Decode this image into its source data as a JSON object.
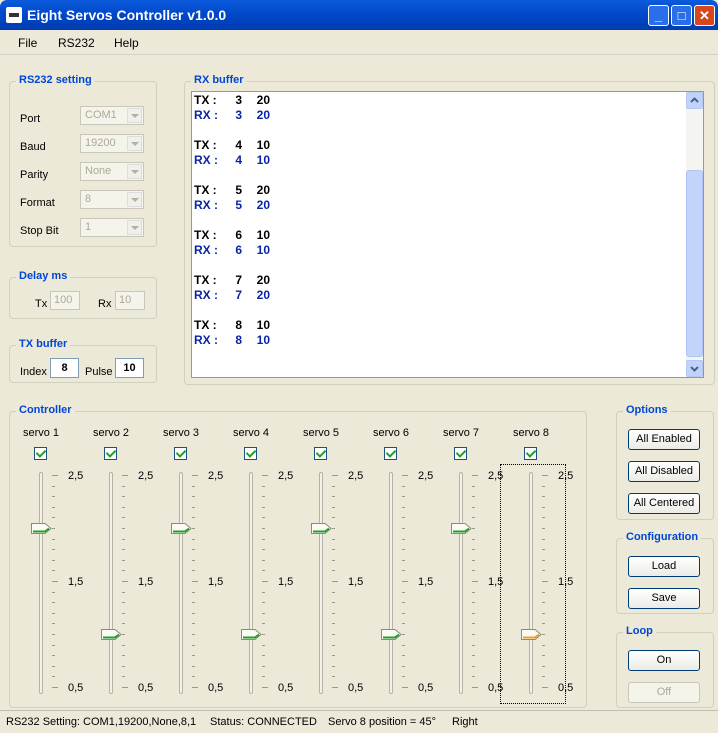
{
  "window": {
    "title": "Eight Servos Controller v1.0.0"
  },
  "menu": {
    "items": [
      "File",
      "RS232",
      "Help"
    ]
  },
  "rs232": {
    "label": "RS232 setting",
    "fields": [
      {
        "label": "Port",
        "value": "COM1"
      },
      {
        "label": "Baud",
        "value": "19200"
      },
      {
        "label": "Parity",
        "value": "None"
      },
      {
        "label": "Format",
        "value": "8"
      },
      {
        "label": "Stop Bit",
        "value": "1"
      }
    ]
  },
  "delay": {
    "label": "Delay ms",
    "tx_label": "Tx",
    "tx_value": "100",
    "rx_label": "Rx",
    "rx_value": "10"
  },
  "txbuffer": {
    "label": "TX buffer",
    "index_label": "Index",
    "index_value": "8",
    "pulse_label": "Pulse",
    "pulse_value": "10"
  },
  "rxbuffer": {
    "label": "RX buffer",
    "lines": [
      {
        "kind": "TX :",
        "a": "3",
        "b": "20"
      },
      {
        "kind": "RX :",
        "a": "3",
        "b": "20"
      },
      {
        "kind": "",
        "a": "",
        "b": ""
      },
      {
        "kind": "TX :",
        "a": "4",
        "b": "10"
      },
      {
        "kind": "RX :",
        "a": "4",
        "b": "10"
      },
      {
        "kind": "",
        "a": "",
        "b": ""
      },
      {
        "kind": "TX :",
        "a": "5",
        "b": "20"
      },
      {
        "kind": "RX :",
        "a": "5",
        "b": "20"
      },
      {
        "kind": "",
        "a": "",
        "b": ""
      },
      {
        "kind": "TX :",
        "a": "6",
        "b": "10"
      },
      {
        "kind": "RX :",
        "a": "6",
        "b": "10"
      },
      {
        "kind": "",
        "a": "",
        "b": ""
      },
      {
        "kind": "TX :",
        "a": "7",
        "b": "20"
      },
      {
        "kind": "RX :",
        "a": "7",
        "b": "20"
      },
      {
        "kind": "",
        "a": "",
        "b": ""
      },
      {
        "kind": "TX :",
        "a": "8",
        "b": "10"
      },
      {
        "kind": "RX :",
        "a": "8",
        "b": "10"
      }
    ]
  },
  "controller": {
    "label": "Controller",
    "scale": {
      "top": "2,5",
      "mid": "1,5",
      "bottom": "0,5",
      "max": 2.5,
      "min": 0.5
    },
    "servos": [
      {
        "name": "servo 1",
        "enabled": true,
        "value": 2.0
      },
      {
        "name": "servo 2",
        "enabled": true,
        "value": 1.0
      },
      {
        "name": "servo 3",
        "enabled": true,
        "value": 2.0
      },
      {
        "name": "servo 4",
        "enabled": true,
        "value": 1.0
      },
      {
        "name": "servo 5",
        "enabled": true,
        "value": 2.0
      },
      {
        "name": "servo 6",
        "enabled": true,
        "value": 1.0
      },
      {
        "name": "servo 7",
        "enabled": true,
        "value": 2.0
      },
      {
        "name": "servo 8",
        "enabled": true,
        "value": 1.0,
        "focused": true
      }
    ]
  },
  "options": {
    "label": "Options",
    "buttons": [
      "All Enabled",
      "All Disabled",
      "All Centered"
    ]
  },
  "configuration": {
    "label": "Configuration",
    "buttons": [
      "Load",
      "Save"
    ]
  },
  "loop": {
    "label": "Loop",
    "on_label": "On",
    "off_label": "Off"
  },
  "status": {
    "setting": "RS232 Setting: COM1,19200,None,8,1",
    "state": "Status: CONNECTED",
    "position": "Servo 8 position = 45°",
    "direction": "Right"
  },
  "colors": {
    "accent": "#0046d5",
    "rx_text": "#0a24a8",
    "slider_green": "#21a121",
    "slider_orange": "#f0a020"
  }
}
